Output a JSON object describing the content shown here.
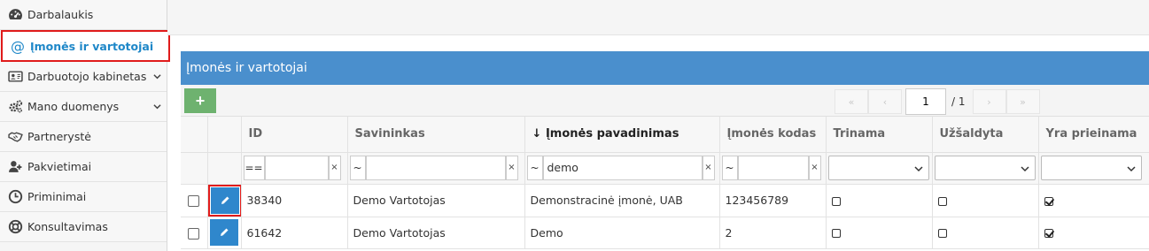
{
  "sidebar": {
    "items": [
      {
        "label": "Darbalaukis",
        "icon": "dashboard-icon"
      },
      {
        "label": "Įmonės ir vartotojai",
        "icon": "at-icon",
        "glyph": "@",
        "active": true
      },
      {
        "label": "Darbuotojo kabinetas",
        "icon": "id-card-icon",
        "expandable": true
      },
      {
        "label": "Mano duomenys",
        "icon": "gears-icon",
        "expandable": true
      },
      {
        "label": "Partnerystė",
        "icon": "handshake-icon"
      },
      {
        "label": "Pakvietimai",
        "icon": "user-plus-icon"
      },
      {
        "label": "Priminimai",
        "icon": "clock-icon"
      },
      {
        "label": "Konsultavimas",
        "icon": "lifebuoy-icon"
      }
    ]
  },
  "panel": {
    "title": "Įmonės ir vartotojai",
    "add_label": "+",
    "pager": {
      "first": "«",
      "prev": "‹",
      "page": "1",
      "total": "/ 1",
      "next": "›",
      "last": "»"
    }
  },
  "grid": {
    "columns": {
      "id": "ID",
      "owner": "Savininkas",
      "sort_arrow": "↓",
      "name": "Įmonės pavadinimas",
      "code": "Įmonės kodas",
      "deleted": "Trinama",
      "frozen": "Užšaldyta",
      "available": "Yra prieinama"
    },
    "filters": {
      "id_op": "==",
      "id_value": "",
      "owner_op": "~",
      "owner_value": "",
      "name_op": "~",
      "name_value": "demo",
      "code_op": "~",
      "code_value": "",
      "clear": "×"
    },
    "rows": [
      {
        "id": "38340",
        "owner": "Demo Vartotojas",
        "name": "Demonstracinė įmonė, UAB",
        "code": "123456789",
        "deleted": false,
        "frozen": false,
        "available": true
      },
      {
        "id": "61642",
        "owner": "Demo Vartotojas",
        "name": "Demo",
        "code": "2",
        "deleted": false,
        "frozen": false,
        "available": true
      }
    ]
  },
  "colors": {
    "accent": "#1e87c8",
    "header_bar": "#4a8fcd",
    "add_button": "#6eb26f",
    "edit_button": "#2f87cc",
    "highlight": "#e01b1b"
  }
}
